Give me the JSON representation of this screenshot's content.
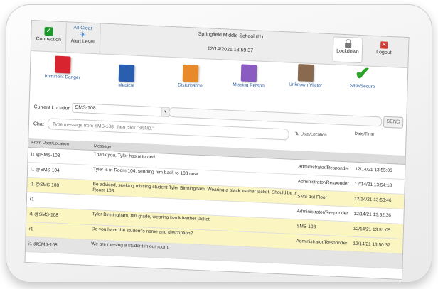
{
  "header": {
    "connection_label": "Connection",
    "alert_status": "All Clear",
    "alert_level_label": "Alert Level",
    "school_name": "Springfield Middle School (I1)",
    "datetime": "12/14/2021 13:59:37",
    "lockdown_label": "Lockdown",
    "logout_label": "Logout"
  },
  "alert_types": [
    {
      "label": "Imminent Danger",
      "color": "#d8242f"
    },
    {
      "label": "Medical",
      "color": "#2a5fb0"
    },
    {
      "label": "Disturbance",
      "color": "#e8892a"
    },
    {
      "label": "Missing Person",
      "color": "#8a5cc2"
    },
    {
      "label": "Unknown Visitor",
      "color": "#8a6a4f"
    },
    {
      "label": "Safe/Secure",
      "color": "#2ea42a"
    }
  ],
  "location": {
    "label": "Current Location",
    "value": "SMS-108",
    "send_label": "SEND"
  },
  "chat": {
    "label": "Chat",
    "placeholder": "Type message from SMS-108, then click \"SEND.\"",
    "col_to": "To User/Location",
    "col_datetime": "Date/Time"
  },
  "table": {
    "col_from": "From User/Location",
    "col_message": "Message",
    "rows": [
      {
        "from": "i1 @SMS-108",
        "message": "Thank you, Tyler has returned.",
        "to": "Administrator/Responder",
        "datetime": "12/14/21 13:55:06",
        "style": "white"
      },
      {
        "from": "i1 @SMS-104",
        "message": "Tyler is in Room 104, sending him back to 108 now.",
        "to": "Administrator/Responder",
        "datetime": "12/14/21 13:54:18",
        "style": "white"
      },
      {
        "from": "i1 @SMS-108",
        "message": "Be advised, seeking missing student Tyler Birmingham. Wearing a black leather jacket. Should be in Room 108.",
        "to": "SMS-1st Floor",
        "datetime": "12/14/21 13:53:46",
        "style": "yellow"
      },
      {
        "from": "r1",
        "message": "",
        "to": "Administrator/Responder",
        "datetime": "12/14/21 13:52:36",
        "style": "white"
      },
      {
        "from": "i1 @SMS-108",
        "message": "Tyler Birmingham, 8th grade, wearing black leather jacket.",
        "to": "SMS-108",
        "datetime": "12/14/21 13:51:05",
        "style": "yellow"
      },
      {
        "from": "r1",
        "message": "Do you have the student's name and description?",
        "to": "Administrator/Responder",
        "datetime": "12/14/21 13:50:37",
        "style": "yellow"
      },
      {
        "from": "i1 @SMS-108",
        "message": "We are missing a student in our room.",
        "to": "",
        "datetime": "",
        "style": "gray"
      }
    ]
  }
}
